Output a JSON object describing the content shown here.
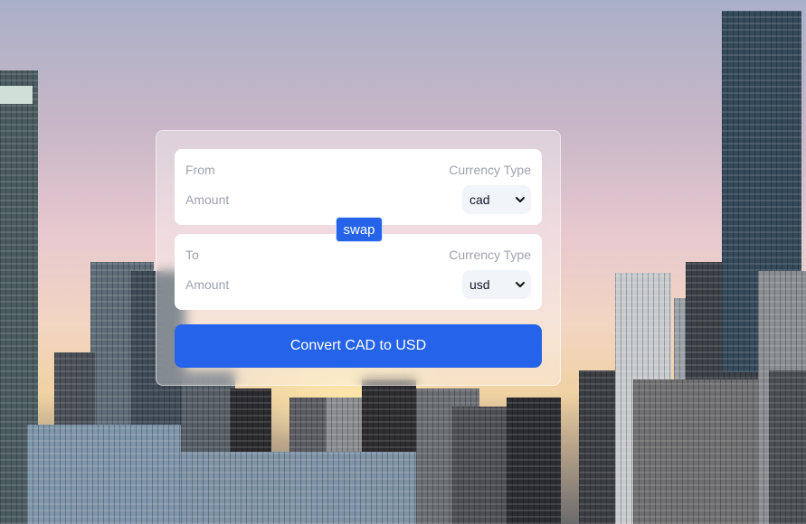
{
  "from": {
    "label": "From",
    "currency_type_label": "Currency Type",
    "amount_placeholder": "Amount",
    "currency": "cad"
  },
  "swap_label": "swap",
  "to": {
    "label": "To",
    "currency_type_label": "Currency Type",
    "amount_placeholder": "Amount",
    "currency": "usd"
  },
  "convert_label": "Convert CAD to USD",
  "colors": {
    "primary": "#2563eb",
    "muted_text": "#9ca3af",
    "select_bg": "#f1f5f9"
  },
  "icons": [
    "chevron-down-icon"
  ]
}
